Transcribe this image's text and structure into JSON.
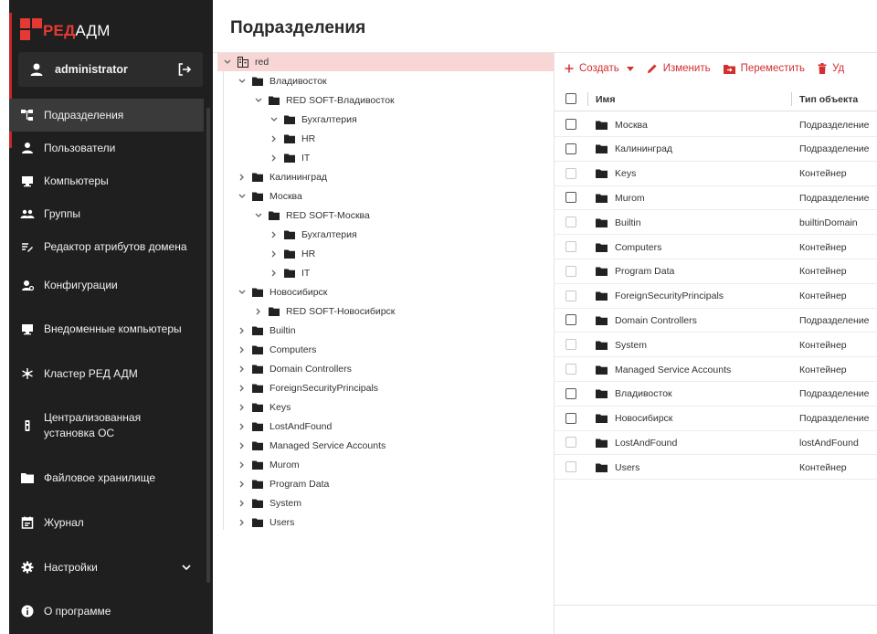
{
  "brand": {
    "part_red": "РЕД",
    "part_white": "АДМ"
  },
  "user": {
    "name": "administrator"
  },
  "sidebar": {
    "items": [
      {
        "label": "Подразделения",
        "icon": "tree-icon",
        "active": true
      },
      {
        "label": "Пользователи",
        "icon": "person-icon"
      },
      {
        "label": "Компьютеры",
        "icon": "monitor-icon"
      },
      {
        "label": "Группы",
        "icon": "group-icon"
      },
      {
        "label": "Редактор атрибутов домена",
        "icon": "edit-list-icon"
      },
      {
        "label": "Конфигурации",
        "icon": "config-icon"
      },
      {
        "label": "Внедоменные компьютеры",
        "icon": "monitor-icon"
      },
      {
        "label": "Кластер РЕД АДМ",
        "icon": "cluster-icon"
      },
      {
        "label": "Централизованная установка ОС",
        "icon": "install-icon"
      },
      {
        "label": "Файловое хранилище",
        "icon": "folder-icon"
      },
      {
        "label": "Журнал",
        "icon": "journal-icon"
      },
      {
        "label": "Настройки",
        "icon": "gear-icon"
      },
      {
        "label": "О программе",
        "icon": "info-icon"
      }
    ]
  },
  "page": {
    "title": "Подразделения"
  },
  "tree": {
    "rows": [
      {
        "label": "red",
        "icon": "domain-icon",
        "expanded": true,
        "selected": true
      },
      {
        "label": "Владивосток",
        "expanded": true
      },
      {
        "label": "RED SOFT-Владивосток",
        "expanded": true
      },
      {
        "label": "Бухгалтерия",
        "expanded": true
      },
      {
        "label": "HR",
        "expanded": false
      },
      {
        "label": "IT",
        "expanded": false
      },
      {
        "label": "Калининград",
        "expanded": false
      },
      {
        "label": "Москва",
        "expanded": true
      },
      {
        "label": "RED SOFT-Москва",
        "expanded": true
      },
      {
        "label": "Бухгалтерия",
        "expanded": false
      },
      {
        "label": "HR",
        "expanded": false
      },
      {
        "label": "IT",
        "expanded": false
      },
      {
        "label": "Новосибирск",
        "expanded": true
      },
      {
        "label": "RED SOFT-Новосибирск",
        "expanded": false
      },
      {
        "label": "Builtin",
        "expanded": false
      },
      {
        "label": "Computers",
        "expanded": false
      },
      {
        "label": "Domain Controllers",
        "expanded": false
      },
      {
        "label": "ForeignSecurityPrincipals",
        "expanded": false
      },
      {
        "label": "Keys",
        "expanded": false
      },
      {
        "label": "LostAndFound",
        "expanded": false
      },
      {
        "label": "Managed Service Accounts",
        "expanded": false
      },
      {
        "label": "Murom",
        "expanded": false
      },
      {
        "label": "Program Data",
        "expanded": false
      },
      {
        "label": "System",
        "expanded": false
      },
      {
        "label": "Users",
        "expanded": false
      }
    ]
  },
  "toolbar": {
    "create": "Создать",
    "edit": "Изменить",
    "move": "Переместить",
    "delete_partial": "Уд"
  },
  "table": {
    "headers": {
      "name": "Имя",
      "type": "Тип объекта"
    },
    "rows": [
      {
        "name": "Москва",
        "type": "Подразделение"
      },
      {
        "name": "Калининград",
        "type": "Подразделение"
      },
      {
        "name": "Keys",
        "type": "Контейнер"
      },
      {
        "name": "Murom",
        "type": "Подразделение"
      },
      {
        "name": "Builtin",
        "type": "builtinDomain"
      },
      {
        "name": "Computers",
        "type": "Контейнер"
      },
      {
        "name": "Program Data",
        "type": "Контейнер"
      },
      {
        "name": "ForeignSecurityPrincipals",
        "type": "Контейнер"
      },
      {
        "name": "Domain Controllers",
        "type": "Подразделение"
      },
      {
        "name": "System",
        "type": "Контейнер"
      },
      {
        "name": "Managed Service Accounts",
        "type": "Контейнер"
      },
      {
        "name": "Владивосток",
        "type": "Подразделение"
      },
      {
        "name": "Новосибирск",
        "type": "Подразделение"
      },
      {
        "name": "LostAndFound",
        "type": "lostAndFound"
      },
      {
        "name": "Users",
        "type": "Контейнер"
      }
    ]
  },
  "colors": {
    "accent": "#d32f2f",
    "sidebar_bg": "#1f1f1f",
    "selected_row": "#f9d6d6"
  }
}
